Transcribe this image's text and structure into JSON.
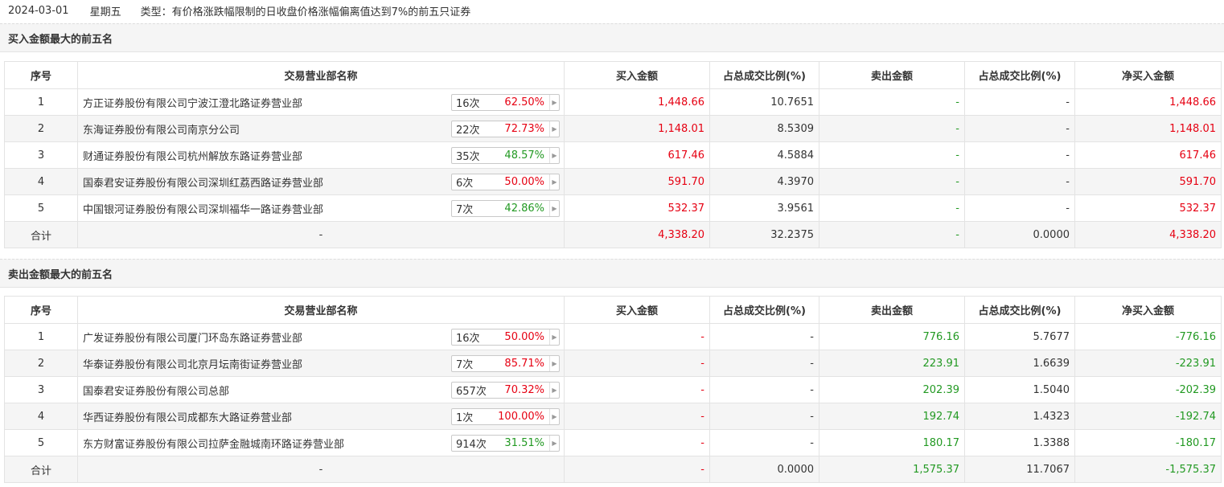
{
  "header": {
    "date": "2024-03-01",
    "weekday": "星期五",
    "type_text": "类型：有价格涨跌幅限制的日收盘价格涨幅偏离值达到7%的前五只证券"
  },
  "colors": {
    "red": "#e60012",
    "green": "#229922",
    "section_bg": "#f5f5f5"
  },
  "columns": [
    "序号",
    "交易营业部名称",
    "买入金额",
    "占总成交比例(%)",
    "卖出金额",
    "占总成交比例(%)",
    "净买入金额"
  ],
  "buy_section": {
    "title": "买入金额最大的前五名",
    "rows": [
      {
        "idx": "1",
        "name": "方正证券股份有限公司宁波江澄北路证券营业部",
        "count": "16次",
        "rate": "62.50%",
        "rate_color": "red",
        "buy": "1,448.66",
        "buy_pct": "10.7651",
        "sell": "-",
        "sell_pct": "-",
        "net": "1,448.66"
      },
      {
        "idx": "2",
        "name": "东海证券股份有限公司南京分公司",
        "count": "22次",
        "rate": "72.73%",
        "rate_color": "red",
        "buy": "1,148.01",
        "buy_pct": "8.5309",
        "sell": "-",
        "sell_pct": "-",
        "net": "1,148.01"
      },
      {
        "idx": "3",
        "name": "财通证券股份有限公司杭州解放东路证券营业部",
        "count": "35次",
        "rate": "48.57%",
        "rate_color": "green",
        "buy": "617.46",
        "buy_pct": "4.5884",
        "sell": "-",
        "sell_pct": "-",
        "net": "617.46"
      },
      {
        "idx": "4",
        "name": "国泰君安证券股份有限公司深圳红荔西路证券营业部",
        "count": "6次",
        "rate": "50.00%",
        "rate_color": "red",
        "buy": "591.70",
        "buy_pct": "4.3970",
        "sell": "-",
        "sell_pct": "-",
        "net": "591.70"
      },
      {
        "idx": "5",
        "name": "中国银河证券股份有限公司深圳福华一路证券营业部",
        "count": "7次",
        "rate": "42.86%",
        "rate_color": "green",
        "buy": "532.37",
        "buy_pct": "3.9561",
        "sell": "-",
        "sell_pct": "-",
        "net": "532.37"
      }
    ],
    "total": {
      "label": "合计",
      "name": "-",
      "buy": "4,338.20",
      "buy_pct": "32.2375",
      "sell": "-",
      "sell_pct": "0.0000",
      "net": "4,338.20"
    }
  },
  "sell_section": {
    "title": "卖出金额最大的前五名",
    "rows": [
      {
        "idx": "1",
        "name": "广发证券股份有限公司厦门环岛东路证券营业部",
        "count": "16次",
        "rate": "50.00%",
        "rate_color": "red",
        "buy": "-",
        "buy_pct": "-",
        "sell": "776.16",
        "sell_pct": "5.7677",
        "net": "-776.16"
      },
      {
        "idx": "2",
        "name": "华泰证券股份有限公司北京月坛南街证券营业部",
        "count": "7次",
        "rate": "85.71%",
        "rate_color": "red",
        "buy": "-",
        "buy_pct": "-",
        "sell": "223.91",
        "sell_pct": "1.6639",
        "net": "-223.91"
      },
      {
        "idx": "3",
        "name": "国泰君安证券股份有限公司总部",
        "count": "657次",
        "rate": "70.32%",
        "rate_color": "red",
        "buy": "-",
        "buy_pct": "-",
        "sell": "202.39",
        "sell_pct": "1.5040",
        "net": "-202.39"
      },
      {
        "idx": "4",
        "name": "华西证券股份有限公司成都东大路证券营业部",
        "count": "1次",
        "rate": "100.00%",
        "rate_color": "red",
        "buy": "-",
        "buy_pct": "-",
        "sell": "192.74",
        "sell_pct": "1.4323",
        "net": "-192.74"
      },
      {
        "idx": "5",
        "name": "东方财富证券股份有限公司拉萨金融城南环路证券营业部",
        "count": "914次",
        "rate": "31.51%",
        "rate_color": "green",
        "buy": "-",
        "buy_pct": "-",
        "sell": "180.17",
        "sell_pct": "1.3388",
        "net": "-180.17"
      }
    ],
    "total": {
      "label": "合计",
      "name": "-",
      "buy": "-",
      "buy_pct": "0.0000",
      "sell": "1,575.37",
      "sell_pct": "11.7067",
      "net": "-1,575.37"
    }
  }
}
